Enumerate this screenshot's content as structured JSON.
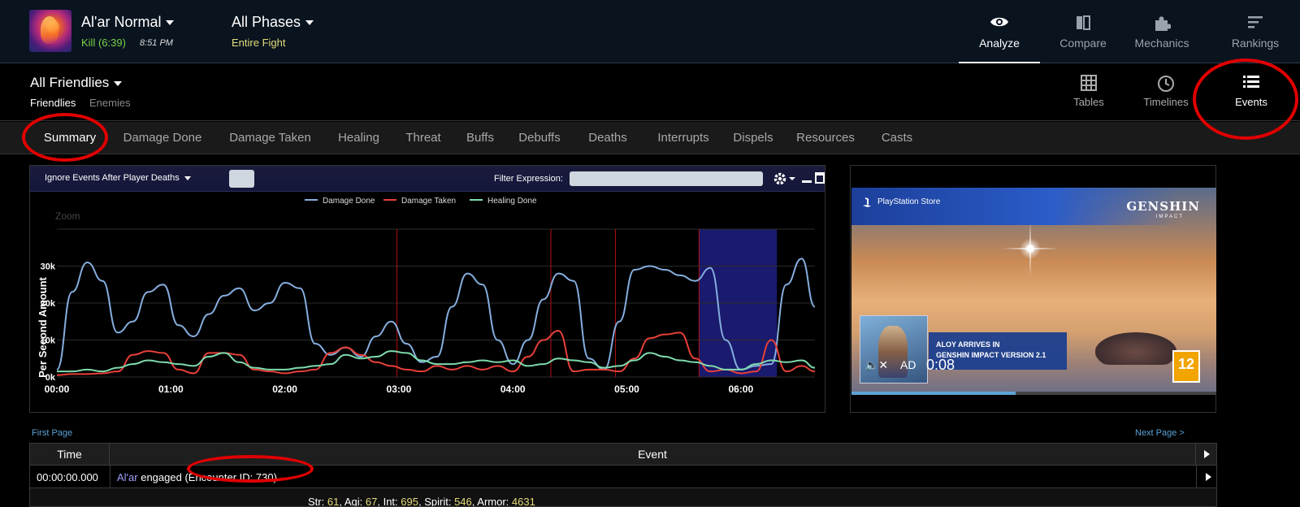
{
  "encounter": {
    "title": "Al'ar Normal",
    "result": "Kill (6:39)",
    "time": "8:51 PM"
  },
  "phase": {
    "title": "All Phases",
    "subtitle": "Entire Fight"
  },
  "top_nav": [
    {
      "label": "Analyze",
      "icon": "eye-icon",
      "active": true
    },
    {
      "label": "Compare",
      "icon": "compare-icon",
      "active": false
    },
    {
      "label": "Mechanics",
      "icon": "puzzle-icon",
      "active": false
    },
    {
      "label": "Rankings",
      "icon": "rankings-icon",
      "active": false
    }
  ],
  "group": {
    "title": "All Friendlies",
    "tabs": [
      "Friendlies",
      "Enemies"
    ]
  },
  "view_nav": [
    {
      "label": "Tables",
      "icon": "grid-icon"
    },
    {
      "label": "Timelines",
      "icon": "clock-icon"
    },
    {
      "label": "Events",
      "icon": "list-icon",
      "active": true
    }
  ],
  "tabs": [
    "Summary",
    "Damage Done",
    "Damage Taken",
    "Healing",
    "Threat",
    "Buffs",
    "Debuffs",
    "Deaths",
    "Interrupts",
    "Dispels",
    "Resources",
    "Casts"
  ],
  "graph_toolbar": {
    "ignore_label": "Ignore Events After Player Deaths",
    "filter_label": "Filter Expression:",
    "filter_value": ""
  },
  "chart_data": {
    "type": "line",
    "title": "",
    "ylabel": "Per Second Amount",
    "xlabel": "",
    "zoom_label": "Zoom",
    "xlim": [
      0,
      399
    ],
    "ylim": [
      0,
      40000
    ],
    "x_ticks": [
      {
        "v": 0,
        "label": "00:00"
      },
      {
        "v": 60,
        "label": "01:00"
      },
      {
        "v": 120,
        "label": "02:00"
      },
      {
        "v": 180,
        "label": "03:00"
      },
      {
        "v": 240,
        "label": "04:00"
      },
      {
        "v": 300,
        "label": "05:00"
      },
      {
        "v": 360,
        "label": "06:00"
      }
    ],
    "y_ticks": [
      {
        "v": 0,
        "label": "0k"
      },
      {
        "v": 10000,
        "label": "10k"
      },
      {
        "v": 20000,
        "label": "20k"
      },
      {
        "v": 30000,
        "label": "30k"
      }
    ],
    "legend": "top-center",
    "grid": true,
    "death_markers": [
      179,
      260,
      294,
      338
    ],
    "highlight_range": [
      338,
      379
    ],
    "colors": {
      "damage_done": "#86aede",
      "damage_taken": "#e8403a",
      "healing_done": "#7edcae",
      "marker": "#b01010",
      "highlight": "#1a1a6e",
      "grid": "#2c2c2c"
    },
    "series": [
      {
        "name": "Damage Done",
        "key": "damage_done",
        "x": [
          0,
          8,
          16,
          24,
          32,
          40,
          48,
          56,
          64,
          72,
          80,
          88,
          96,
          104,
          112,
          120,
          128,
          136,
          144,
          152,
          160,
          168,
          176,
          184,
          192,
          200,
          208,
          216,
          224,
          232,
          240,
          248,
          256,
          264,
          272,
          280,
          288,
          296,
          304,
          312,
          320,
          328,
          336,
          344,
          352,
          360,
          368,
          376,
          384,
          392,
          399
        ],
        "values": [
          2000,
          23000,
          31000,
          26000,
          12000,
          15000,
          23000,
          25000,
          14000,
          11000,
          17000,
          22000,
          24000,
          18000,
          20000,
          25500,
          24000,
          9000,
          6000,
          8000,
          5500,
          11000,
          15000,
          9000,
          4000,
          5500,
          19000,
          28000,
          25000,
          10000,
          3500,
          10000,
          21000,
          28000,
          26000,
          5000,
          2000,
          15000,
          29000,
          30000,
          29000,
          27500,
          26000,
          29500,
          10000,
          2000,
          3000,
          3500,
          25000,
          32000,
          19000
        ]
      },
      {
        "name": "Damage Taken",
        "key": "damage_taken",
        "x": [
          0,
          8,
          16,
          24,
          32,
          40,
          48,
          56,
          64,
          72,
          80,
          88,
          96,
          104,
          112,
          120,
          128,
          136,
          144,
          152,
          160,
          168,
          176,
          184,
          192,
          200,
          208,
          216,
          224,
          232,
          240,
          248,
          256,
          264,
          272,
          280,
          288,
          296,
          304,
          312,
          320,
          328,
          336,
          344,
          352,
          360,
          368,
          376,
          384,
          392,
          399
        ],
        "values": [
          500,
          800,
          800,
          1000,
          1500,
          6000,
          7000,
          6500,
          2000,
          1000,
          6500,
          6500,
          6000,
          2000,
          1500,
          1000,
          1500,
          2000,
          6500,
          8000,
          6000,
          4000,
          3000,
          2000,
          1500,
          3000,
          2000,
          3000,
          2000,
          3000,
          1500,
          5500,
          10000,
          12500,
          1500,
          2000,
          2000,
          1500,
          5000,
          10500,
          11500,
          12000,
          5000,
          1500,
          2000,
          1000,
          1500,
          10000,
          1500,
          3000,
          1500
        ]
      },
      {
        "name": "Healing Done",
        "key": "healing_done",
        "x": [
          0,
          8,
          16,
          24,
          32,
          40,
          48,
          56,
          64,
          72,
          80,
          88,
          96,
          104,
          112,
          120,
          128,
          136,
          144,
          152,
          160,
          168,
          176,
          184,
          192,
          200,
          208,
          216,
          224,
          232,
          240,
          248,
          256,
          264,
          272,
          280,
          288,
          296,
          304,
          312,
          320,
          328,
          336,
          344,
          352,
          360,
          368,
          376,
          384,
          392,
          399
        ],
        "values": [
          1500,
          1500,
          2000,
          1500,
          2500,
          3500,
          4500,
          4000,
          3500,
          3000,
          5500,
          6500,
          4000,
          2500,
          2000,
          2000,
          2500,
          3000,
          3500,
          6000,
          5000,
          5500,
          7000,
          6500,
          4500,
          3500,
          3500,
          4000,
          4500,
          4000,
          4500,
          3000,
          3500,
          5000,
          4500,
          4000,
          2500,
          3000,
          4500,
          6500,
          5500,
          4500,
          4000,
          3000,
          2000,
          2000,
          3500,
          4500,
          4000,
          4500,
          2500
        ]
      }
    ]
  },
  "ad": {
    "store_label": "PlayStation Store",
    "brand": "GENSHIN",
    "brand_sub": "IMPACT",
    "headline_1": "ALOY ARRIVES IN",
    "headline_2": "GENSHIN IMPACT VERSION 2.1",
    "ad_label": "AD",
    "timer": "0:08",
    "rating": "12",
    "progress": 0.45
  },
  "pagination": {
    "first": "First Page",
    "next": "Next Page >"
  },
  "events": {
    "headers": [
      "Time",
      "Event"
    ],
    "rows": [
      {
        "time": "00:00:00.000",
        "actor": "Al'ar",
        "action": " engaged ",
        "detail": "(Encounter ID: 730)"
      }
    ],
    "stats": [
      {
        "label": "Str:",
        "value": "61"
      },
      {
        "label": "Agi:",
        "value": "67"
      },
      {
        "label": "Int:",
        "value": "695"
      },
      {
        "label": "Spirit:",
        "value": "546"
      },
      {
        "label": "Armor:",
        "value": "4631"
      }
    ]
  }
}
